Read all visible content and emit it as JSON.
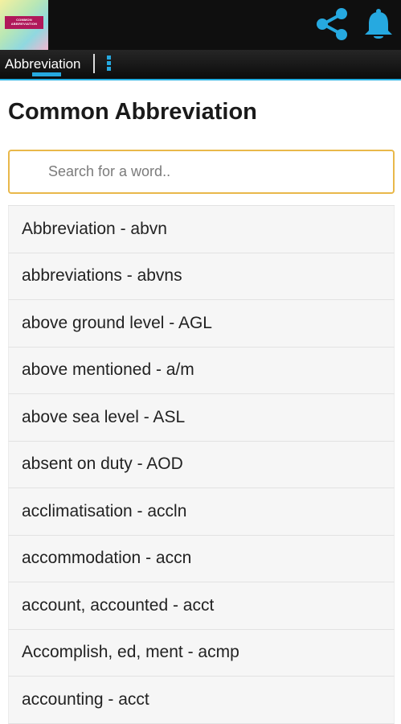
{
  "app": {
    "logo_text": [
      "COMMON",
      "ABBREVIATION"
    ]
  },
  "icons": {
    "share": "share-icon",
    "notifications": "bell-icon",
    "overflow": "more-vert-icon"
  },
  "tabs": [
    {
      "label": "Abbreviation",
      "selected": true
    }
  ],
  "colors": {
    "accent": "#23aee2",
    "search_border": "#e9b84a",
    "appbar": "#0f0f0f"
  },
  "page_title": "Common Abbreviation",
  "search": {
    "placeholder": "Search for a word..",
    "value": ""
  },
  "items": [
    "Abbreviation - abvn",
    "abbreviations - abvns",
    "above ground level - AGL",
    "above mentioned - a/m",
    "above sea level - ASL",
    "absent on duty - AOD",
    "acclimatisation - accln",
    "accommodation - accn",
    "account, accounted - acct",
    "Accomplish, ed, ment - acmp",
    "accounting - acct"
  ]
}
